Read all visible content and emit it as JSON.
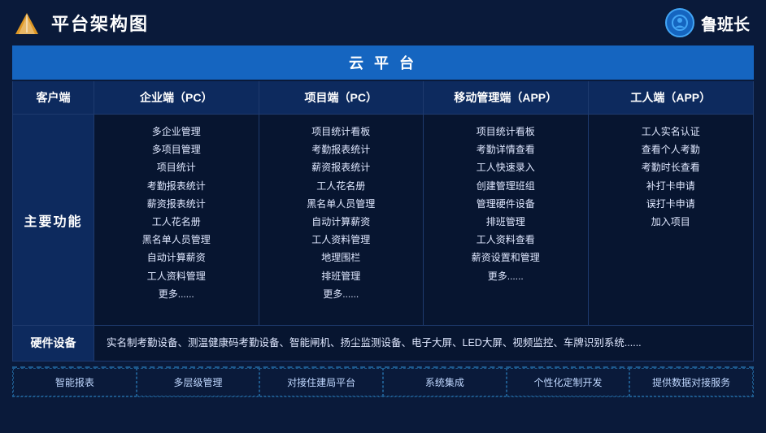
{
  "header": {
    "title": "平台架构图",
    "brand_name": "鲁班长",
    "brand_icon": "🏗"
  },
  "cloud_platform": {
    "label": "云 平 台"
  },
  "columns": [
    {
      "id": "client",
      "label": "客户端"
    },
    {
      "id": "enterprise",
      "label": "企业端（PC）"
    },
    {
      "id": "project",
      "label": "项目端（PC）"
    },
    {
      "id": "mobile",
      "label": "移动管理端（APP）"
    },
    {
      "id": "worker",
      "label": "工人端（APP）"
    }
  ],
  "row_label": "主要功能",
  "features": {
    "enterprise": [
      "多企业管理",
      "多项目管理",
      "项目统计",
      "考勤报表统计",
      "薪资报表统计",
      "工人花名册",
      "黑名单人员管理",
      "自动计算薪资",
      "工人资料管理",
      "更多......"
    ],
    "project": [
      "项目统计看板",
      "考勤报表统计",
      "薪资报表统计",
      "工人花名册",
      "黑名单人员管理",
      "自动计算薪资",
      "工人资料管理",
      "地理围栏",
      "排班管理",
      "更多......"
    ],
    "mobile": [
      "项目统计看板",
      "考勤详情查看",
      "工人快速录入",
      "创建管理班组",
      "管理硬件设备",
      "排班管理",
      "工人资料查看",
      "薪资设置和管理",
      "更多......"
    ],
    "worker": [
      "工人实名认证",
      "查看个人考勤",
      "考勤时长查看",
      "补打卡申请",
      "误打卡申请",
      "加入项目"
    ]
  },
  "hardware": {
    "label": "硬件设备",
    "content": "实名制考勤设备、测温健康码考勤设备、智能闸机、扬尘监测设备、电子大屏、LED大屏、视频监控、车牌识别系统......"
  },
  "bottom_features": [
    "智能报表",
    "多层级管理",
    "对接住建局平台",
    "系统集成",
    "个性化定制开发",
    "提供数据对接服务"
  ]
}
